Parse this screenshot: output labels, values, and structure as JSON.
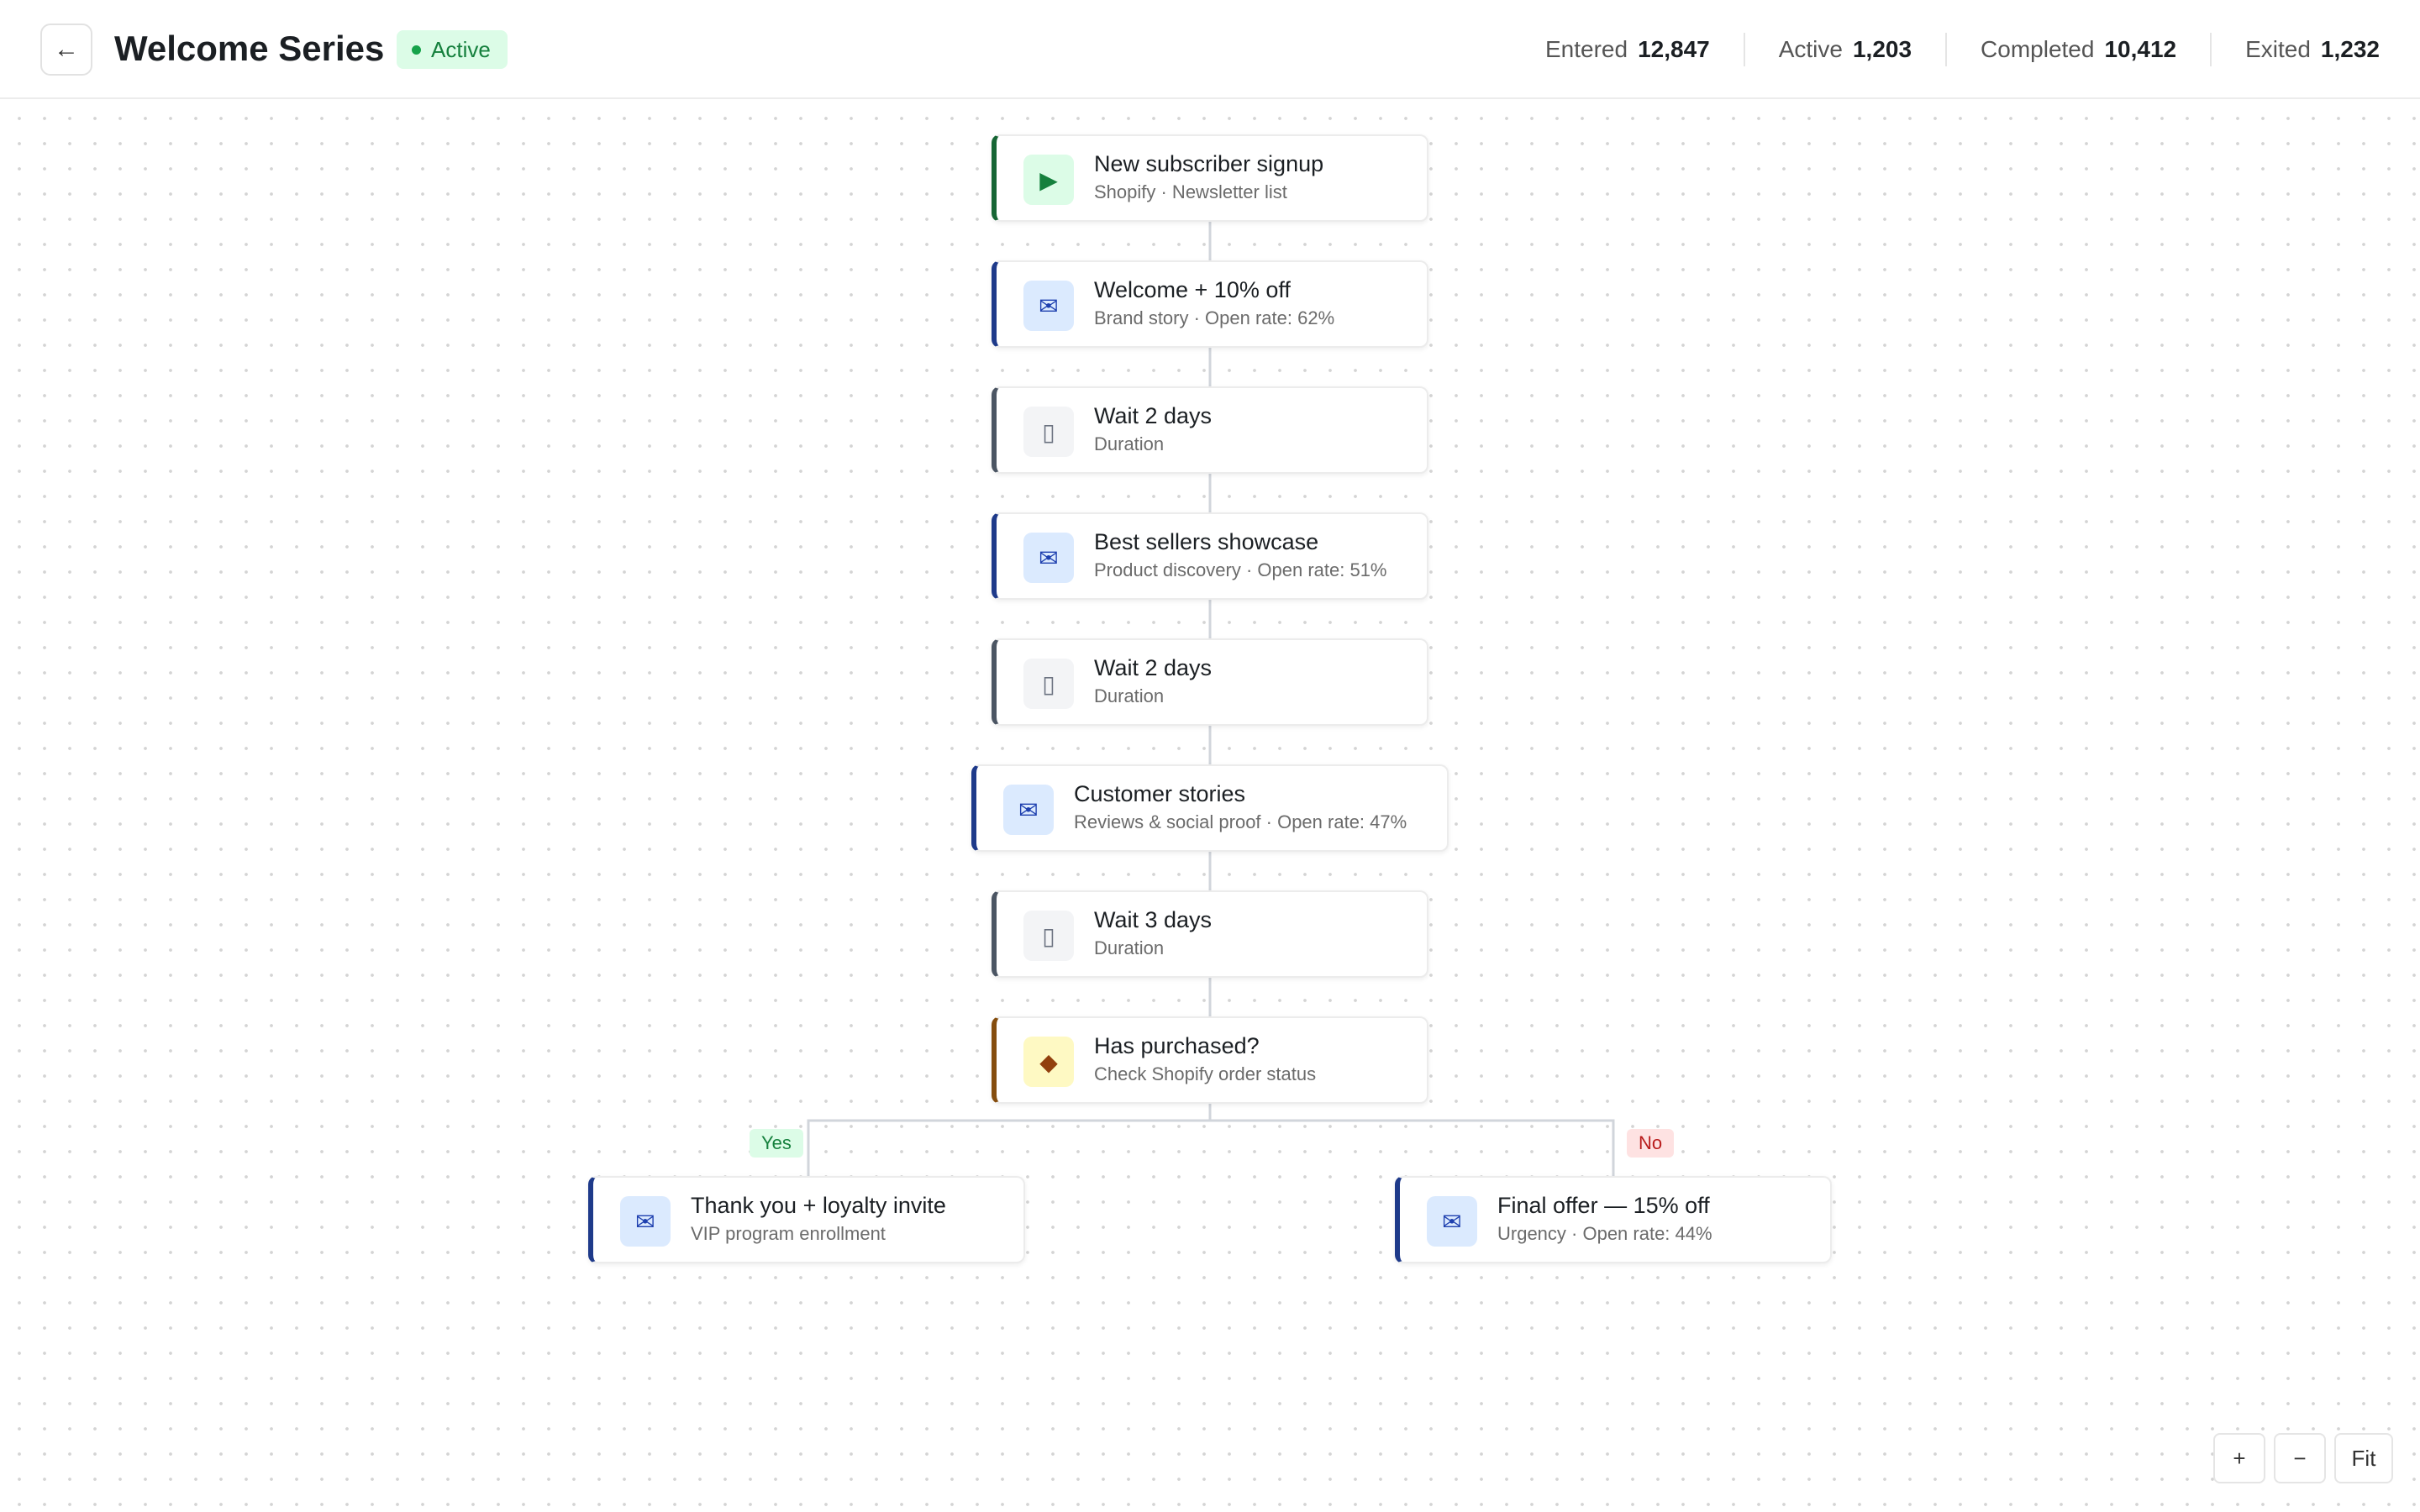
{
  "header": {
    "back_icon": "←",
    "title": "Welcome Series",
    "status": "Active",
    "stats": [
      {
        "label": "Entered",
        "value": "12,847"
      },
      {
        "label": "Active",
        "value": "1,203"
      },
      {
        "label": "Completed",
        "value": "10,412"
      },
      {
        "label": "Exited",
        "value": "1,232"
      }
    ]
  },
  "flow": {
    "nodes": [
      {
        "type": "trigger",
        "icon": "play-icon",
        "glyph": "▶",
        "title": "New subscriber signup",
        "subtitle": "Shopify · Newsletter list"
      },
      {
        "type": "email",
        "icon": "mail-icon",
        "glyph": "✉",
        "title": "Welcome + 10% off",
        "subtitle": "Brand story · Open rate: 62%"
      },
      {
        "type": "wait",
        "icon": "hourglass-icon",
        "glyph": "▯",
        "title": "Wait 2 days",
        "subtitle": "Duration"
      },
      {
        "type": "email",
        "icon": "mail-icon",
        "glyph": "✉",
        "title": "Best sellers showcase",
        "subtitle": "Product discovery · Open rate: 51%"
      },
      {
        "type": "wait",
        "icon": "hourglass-icon",
        "glyph": "▯",
        "title": "Wait 2 days",
        "subtitle": "Duration"
      },
      {
        "type": "email",
        "icon": "mail-icon",
        "glyph": "✉",
        "title": "Customer stories",
        "subtitle": "Reviews & social proof · Open rate: 47%"
      },
      {
        "type": "wait",
        "icon": "hourglass-icon",
        "glyph": "▯",
        "title": "Wait 3 days",
        "subtitle": "Duration"
      },
      {
        "type": "condition",
        "icon": "diamond-icon",
        "glyph": "◆",
        "title": "Has purchased?",
        "subtitle": "Check Shopify order status"
      }
    ],
    "branches": {
      "yes": {
        "label": "Yes",
        "node": {
          "type": "email",
          "icon": "mail-icon",
          "glyph": "✉",
          "title": "Thank you + loyalty invite",
          "subtitle": "VIP program enrollment"
        }
      },
      "no": {
        "label": "No",
        "node": {
          "type": "email",
          "icon": "mail-icon",
          "glyph": "✉",
          "title": "Final offer — 15% off",
          "subtitle": "Urgency · Open rate: 44%"
        }
      }
    }
  },
  "zoom": {
    "in": "+",
    "out": "−",
    "fit": "Fit"
  },
  "colors": {
    "trigger": "#166534",
    "email": "#1e3a8a",
    "wait": "#4b5563",
    "condition": "#854d0e",
    "active_badge_bg": "#dcfce7",
    "active_badge_text": "#15803d"
  }
}
